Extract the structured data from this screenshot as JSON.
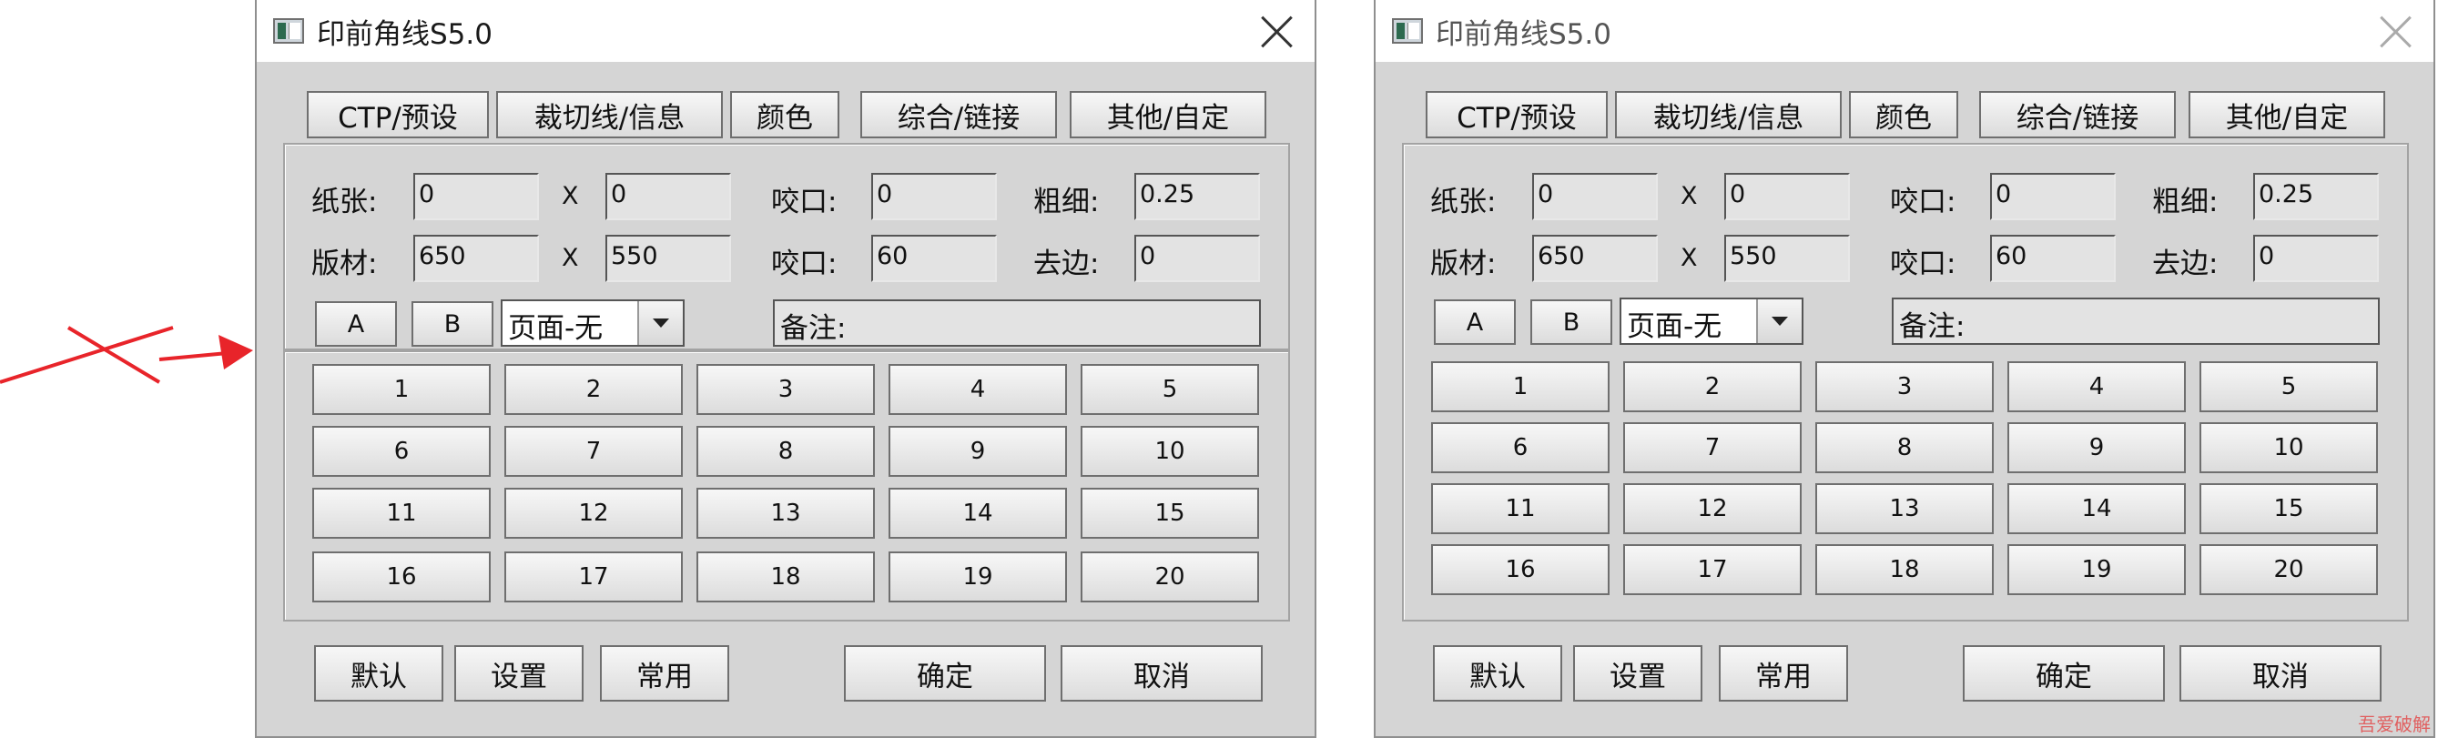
{
  "window": {
    "title": "印前角线S5.0"
  },
  "tabs": [
    "CTP/预设",
    "裁切线/信息",
    "颜色",
    "综合/链接",
    "其他/自定"
  ],
  "params": {
    "paper_label": "纸张:",
    "paper_w": "0",
    "paper_h": "0",
    "x_label": "X",
    "bite1_label": "咬口:",
    "bite1": "0",
    "thickness_label": "粗细:",
    "thickness": "0.25",
    "plate_label": "版材:",
    "plate_w": "650",
    "plate_h": "550",
    "bite2_label": "咬口:",
    "bite2": "60",
    "trim_label": "去边:",
    "trim": "0"
  },
  "controls": {
    "a_label": "A",
    "b_label": "B",
    "page_select": "页面-无",
    "note": "备注:"
  },
  "presets": [
    "1",
    "2",
    "3",
    "4",
    "5",
    "6",
    "7",
    "8",
    "9",
    "10",
    "11",
    "12",
    "13",
    "14",
    "15",
    "16",
    "17",
    "18",
    "19",
    "20"
  ],
  "footer": {
    "default": "默认",
    "settings": "设置",
    "common": "常用",
    "ok": "确定",
    "cancel": "取消"
  },
  "annotation": {
    "color": "#e8242a"
  },
  "watermark": "吾爱破解"
}
